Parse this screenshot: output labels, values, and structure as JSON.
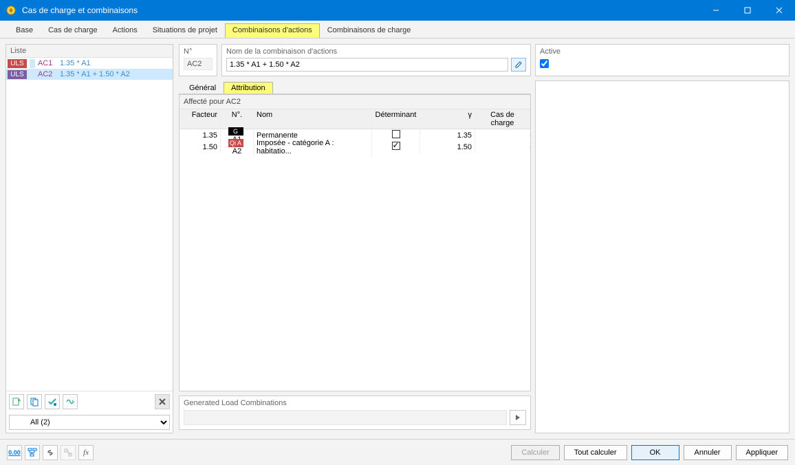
{
  "window": {
    "title": "Cas de charge et combinaisons"
  },
  "tabs": {
    "items": [
      "Base",
      "Cas de charge",
      "Actions",
      "Situations de projet",
      "Combinaisons d'actions",
      "Combinaisons de charge"
    ],
    "active": 4
  },
  "listPane": {
    "header": "Liste",
    "rows": [
      {
        "type": "ULS",
        "typeClass": "uls1",
        "id": "AC1",
        "name": "1.35 * A1"
      },
      {
        "type": "ULS",
        "typeClass": "uls2",
        "id": "AC2",
        "name": "1.35 * A1 + 1.50 * A2"
      }
    ],
    "selected": 1,
    "filter": "All (2)"
  },
  "fields": {
    "numberLabel": "N°",
    "numberValue": "AC2",
    "nameLabel": "Nom de la combinaison d'actions",
    "nameValue": "1.35 * A1 + 1.50 * A2",
    "activeLabel": "Active",
    "activeChecked": true
  },
  "subtabs": {
    "items": [
      "Général",
      "Attribution"
    ],
    "active": 1
  },
  "attribution": {
    "panelTitle": "Affecté pour AC2",
    "columns": {
      "facteur": "Facteur",
      "no": "N°.",
      "nom": "Nom",
      "det": "Déterminant",
      "gamma": "γ",
      "cas": "Cas de charge"
    },
    "rows": [
      {
        "facteur": "1.35",
        "catClass": "cat-g",
        "catText": "G",
        "no": "A1",
        "nom": "Permanente",
        "det": false,
        "gamma": "1.35"
      },
      {
        "facteur": "1.50",
        "catClass": "cat-q",
        "catText": "Qi A",
        "no": "A2",
        "nom": "Imposée - catégorie A : habitatio...",
        "det": true,
        "gamma": "1.50"
      }
    ]
  },
  "generated": {
    "label": "Generated Load Combinations"
  },
  "buttons": {
    "calculer": "Calculer",
    "tout": "Tout calculer",
    "ok": "OK",
    "annuler": "Annuler",
    "appliquer": "Appliquer"
  }
}
